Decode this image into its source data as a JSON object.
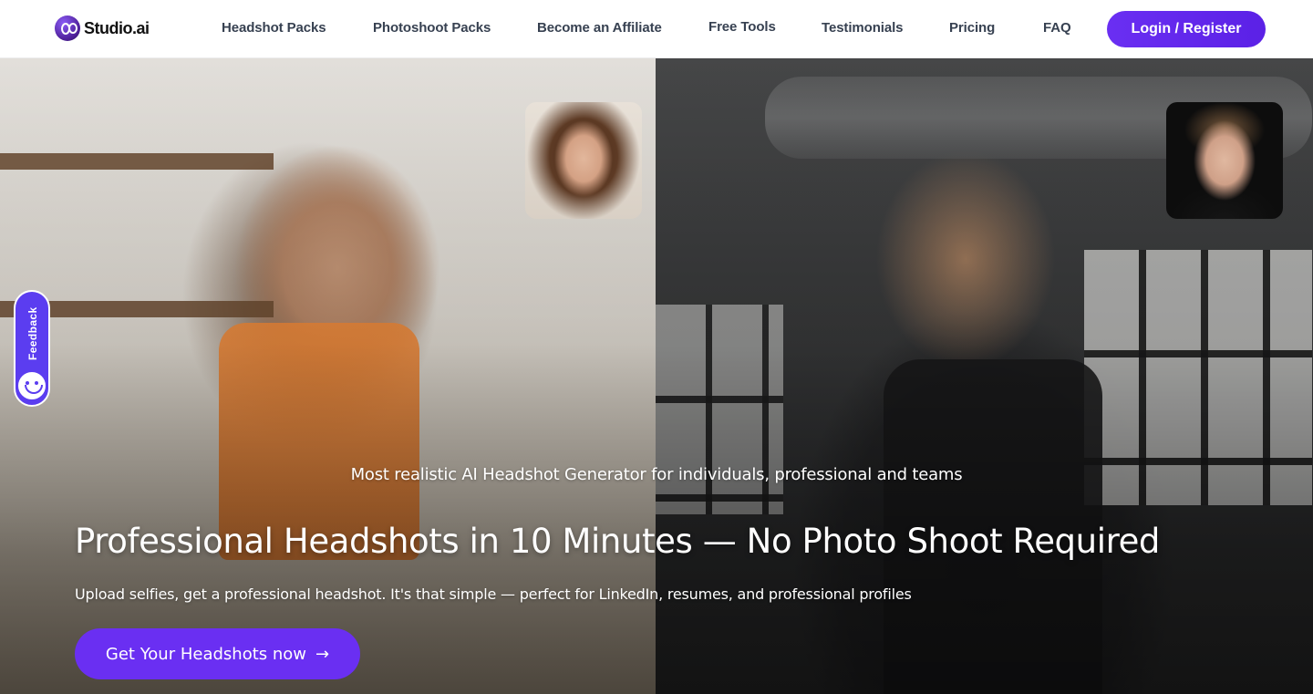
{
  "brand": {
    "name": "Studio.ai",
    "logo_icon": "go-logo-icon"
  },
  "nav": {
    "items": [
      {
        "label": "Headshot Packs"
      },
      {
        "label": "Photoshoot Packs"
      },
      {
        "label": "Become an Affiliate"
      },
      {
        "label": "Free Tools"
      },
      {
        "label": "Testimonials"
      },
      {
        "label": "Pricing"
      },
      {
        "label": "FAQ"
      }
    ],
    "login_label": "Login / Register"
  },
  "feedback": {
    "label": "Feedback",
    "icon": "smiley-icon"
  },
  "hero": {
    "tagline": "Most realistic AI Headshot Generator for individuals, professional and teams",
    "headline": "Professional Headshots in 10 Minutes — No Photo Shoot Required",
    "subtext": "Upload selfies, get a professional headshot. It's that simple — perfect for LinkedIn, resumes, and professional profiles",
    "cta_label": "Get Your Headshots now",
    "cta_icon": "arrow-right-icon"
  },
  "colors": {
    "accent": "#6a2ff2",
    "feedback": "#5b3df0",
    "nav_text": "#374151"
  }
}
